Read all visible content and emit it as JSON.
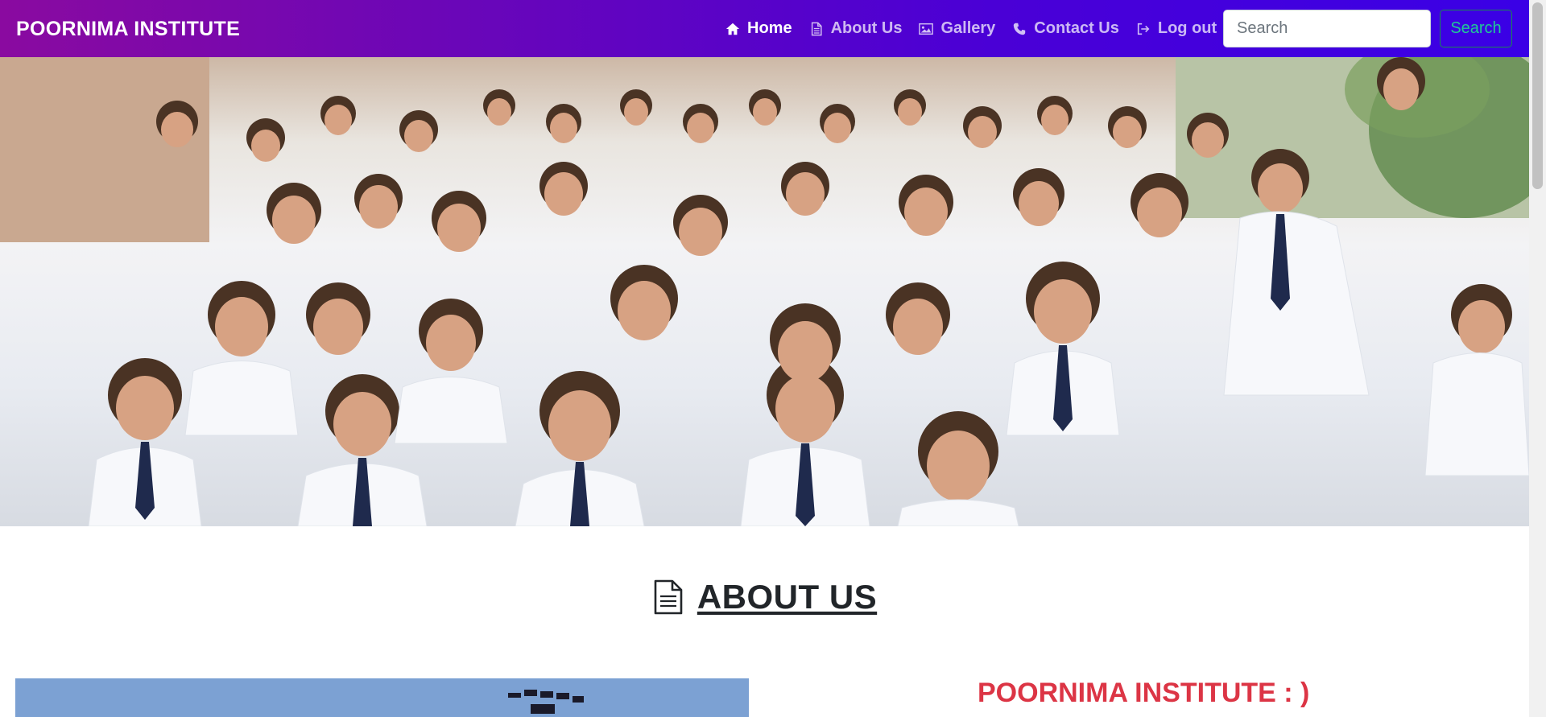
{
  "navbar": {
    "brand": "POORNIMA INSTITUTE",
    "items": [
      {
        "label": "Home",
        "icon": "home-icon",
        "active": true
      },
      {
        "label": "About Us",
        "icon": "document-icon",
        "active": false
      },
      {
        "label": "Gallery",
        "icon": "image-icon",
        "active": false
      },
      {
        "label": "Contact Us",
        "icon": "phone-icon",
        "active": false
      },
      {
        "label": "Log out",
        "icon": "logout-icon",
        "active": false
      }
    ],
    "search_placeholder": "Search",
    "search_button": "Search",
    "colors": {
      "gradient_start": "#8a0aa0",
      "gradient_end": "#3a00e6",
      "search_button": "#20c997"
    }
  },
  "hero": {
    "image": "group-photo-students-in-white-shirts-and-ties"
  },
  "about": {
    "heading": "ABOUT US",
    "icon": "document-icon",
    "campus_image": "campus-building-sign",
    "institute_title": "POORNIMA INSTITUTE : )",
    "title_color": "#dc3545"
  }
}
